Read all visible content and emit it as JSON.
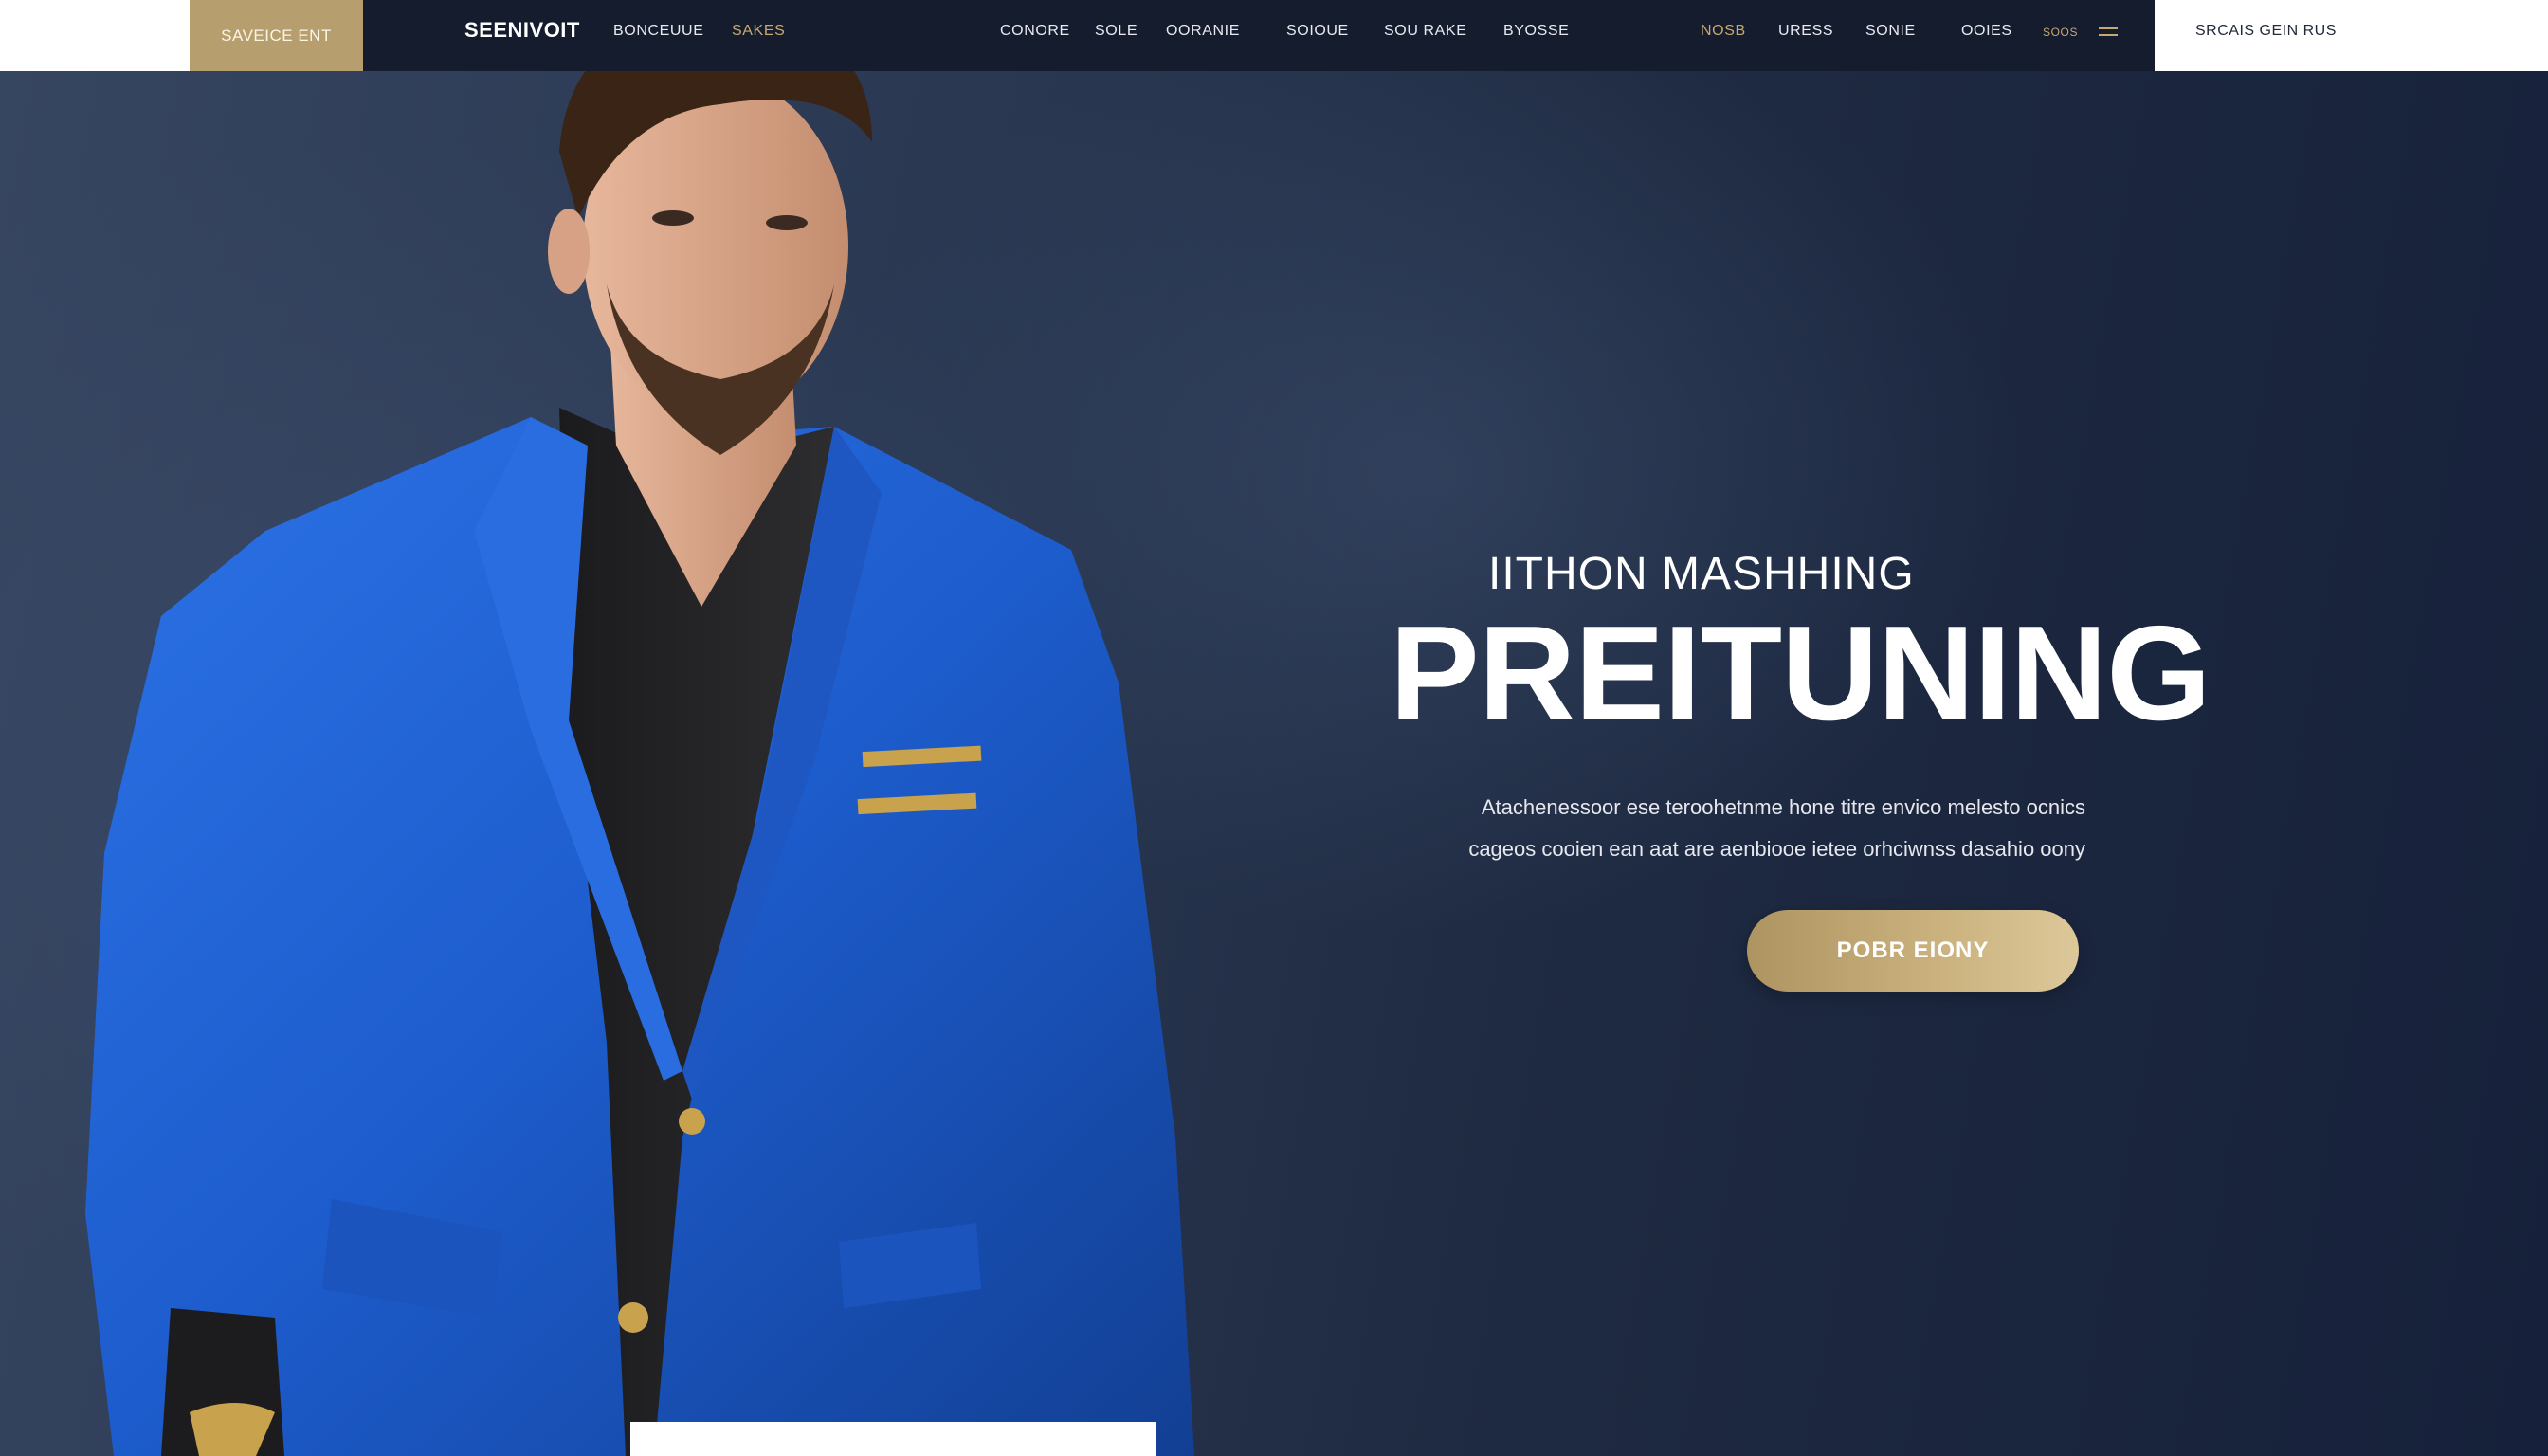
{
  "nav": {
    "promo": "SAVEICE ENT",
    "brand": "SEENIVOIT",
    "left_links": [
      "BONCEUUE",
      "SAKES"
    ],
    "center_links": [
      "CONORE",
      "SOLE",
      "OORANIE",
      "SOIOUE",
      "SOU RAKE",
      "BYOSSE"
    ],
    "right_links": [
      "NOSB",
      "URESS",
      "SONIE",
      "OOIES",
      "SOOS"
    ],
    "sign_in": "SRCAIS GEIN RUS"
  },
  "hero": {
    "eyebrow": "IITHON MASHHING",
    "headline": "PREITUNING",
    "body_line_1": "Atachenessoor ese teroohetnme hone titre envico melesto ocnics",
    "body_line_2": "cageos cooien ean aat are aenbiooe ietee orhciwnss dasahio oony",
    "cta_label": "POBR EIONY"
  },
  "colors": {
    "nav_bg": "#141c2e",
    "accent_gold": "#c9a870",
    "suit_blue": "#1f5fd0",
    "hero_bg": "#1f2b42"
  },
  "icons": {
    "menu": "hamburger-icon"
  }
}
